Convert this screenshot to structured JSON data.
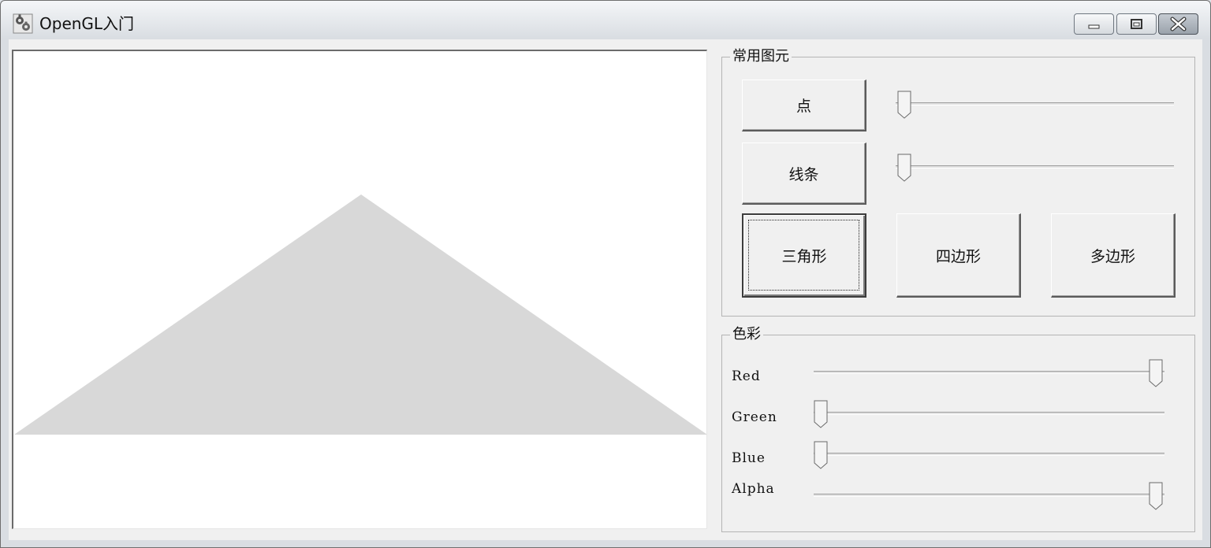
{
  "window": {
    "title": "OpenGL入门",
    "app_icon": "gears-icon",
    "controls": [
      "minimize-icon",
      "maximize-icon",
      "close-icon"
    ]
  },
  "canvas": {
    "background": "#ffffff",
    "shape": "triangle",
    "shape_color": "#d8d8d8"
  },
  "primitives_group": {
    "title": "常用图元",
    "buttons": {
      "point": "点",
      "line": "线条",
      "triangle": "三角形",
      "quad": "四边形",
      "polygon": "多边形"
    },
    "default_button": "triangle",
    "point_size_slider": 0,
    "line_width_slider": 0
  },
  "color_group": {
    "title": "色彩",
    "sliders": [
      {
        "label": "Red",
        "value": 1.0
      },
      {
        "label": "Green",
        "value": 0.0
      },
      {
        "label": "Blue",
        "value": 0.0
      },
      {
        "label": "Alpha",
        "value": 1.0
      }
    ]
  }
}
